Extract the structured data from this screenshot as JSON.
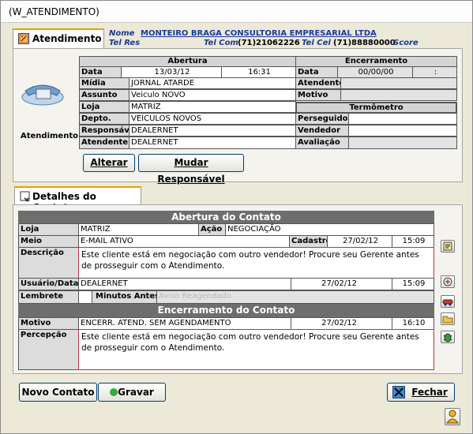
{
  "window": {
    "title": "(W_ATENDIMENTO)"
  },
  "tab_atendimento": {
    "label": "Atendimento"
  },
  "header": {
    "nome_label": "Nome",
    "nome_value": "MONTEIRO BRAGA CONSULTORIA EMPRESARIAL LTDA",
    "telres_label": "Tel Res",
    "telcom_label": "Tel Com",
    "telcom_value": "(71)21062226",
    "telcel_label": "Tel Cel",
    "telcel_value": "(71)88880000",
    "score_label": "Score"
  },
  "atendimento_caption": "Atendimento",
  "abertura": {
    "header": "Abertura",
    "data_label": "Data",
    "data_value": "13/03/12",
    "hora_value": "16:31",
    "midia_label": "Mídia",
    "midia_value": "JORNAL ATARDE",
    "assunto_label": "Assunto",
    "assunto_value": "Veiculo NOVO",
    "loja_label": "Loja",
    "loja_value": "MATRIZ",
    "depto_label": "Depto.",
    "depto_value": "VEICULOS NOVOS",
    "responsavel_label": "Responsável",
    "responsavel_value": "DEALERNET",
    "atendente_label": "Atendente",
    "atendente_value": "DEALERNET"
  },
  "encerramento": {
    "header": "Encerramento",
    "data_label": "Data",
    "data_value": "00/00/00",
    "hora_value": ":",
    "atendente_label": "Atendente",
    "motivo_label": "Motivo"
  },
  "termometro": {
    "header": "Termômetro",
    "perseguidor_label": "Perseguidor",
    "vendedor_label": "Vendedor",
    "avaliacao_label": "Avaliação"
  },
  "buttons": {
    "alterar": "Alterar",
    "mudar_responsavel": "Mudar Responsável",
    "novo_contato": "Novo Contato",
    "gravar": "Gravar",
    "fechar": "Fechar"
  },
  "tab_detalhes": {
    "label": "Detalhes do Contato"
  },
  "contato": {
    "abertura_header": "Abertura do Contato",
    "loja_label": "Loja",
    "loja_value": "MATRIZ",
    "acao_label": "Ação",
    "acao_value": "NEGOCIAÇÃO",
    "meio_label": "Meio",
    "meio_value": "E-MAIL ATIVO",
    "cadastro_label": "Cadastro",
    "cadastro_date": "27/02/12",
    "cadastro_time": "15:09",
    "descricao_label": "Descrição",
    "descricao_text": "Este cliente está em negociação com outro vendedor! Procure seu Gerente antes  de prosseguir com o Atendimento.",
    "usuario_label": "Usuário/Data",
    "usuario_value": "DEALERNET",
    "usuario_date": "27/02/12",
    "usuario_time": "15:09",
    "lembrete_label": "Lembrete",
    "minutos_label": "Minutos Antes",
    "aviso_text": "Aviso Reagendado",
    "encerramento_header": "Encerramento do Contato",
    "motivo_label": "Motivo",
    "motivo_value": "ENCERR. ATEND. SEM AGENDAMENTO",
    "motivo_date": "27/02/12",
    "motivo_time": "16:10",
    "percepcao_label": "Percepção",
    "percepcao_text": "Este cliente está em negociação com outro vendedor! Procure seu Gerente antes  de prosseguir com o Atendimento."
  }
}
